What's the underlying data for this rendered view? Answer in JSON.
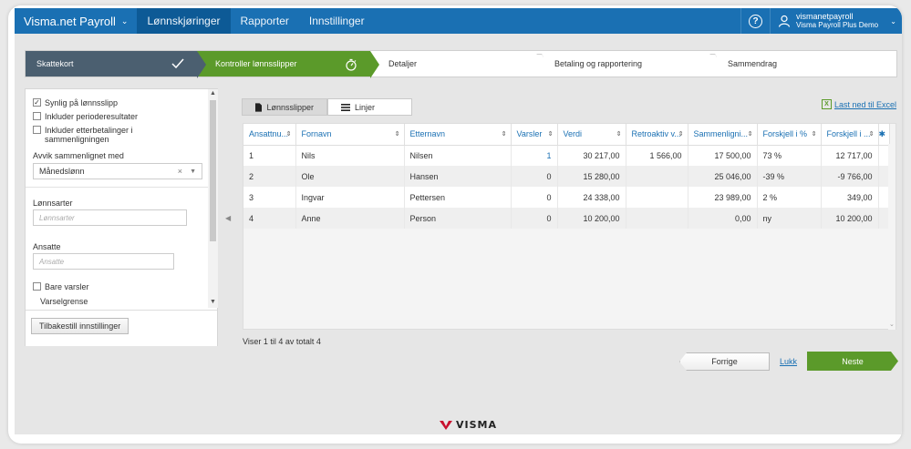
{
  "topbar": {
    "brand": "Visma.net Payroll",
    "nav": [
      "Lønnskjøringer",
      "Rapporter",
      "Innstillinger"
    ],
    "active_nav": "Lønnskjøringer",
    "user_name": "vismanetpayroll",
    "user_company": "Visma Payroll Plus Demo"
  },
  "wizard": {
    "steps": [
      "Skattekort",
      "Kontroller lønnsslipper",
      "Detaljer",
      "Betaling og rapportering",
      "Sammendrag"
    ],
    "current": "Kontroller lønnsslipper"
  },
  "filters": {
    "checkbox_visible": "Synlig på lønnsslipp",
    "checkbox_visible_checked": true,
    "checkbox_period": "Inkluder perioderesultater",
    "checkbox_after": "Inkluder etterbetalinger i sammenligningen",
    "compare_label": "Avvik sammenlignet med",
    "compare_value": "Månedslønn",
    "wage_types_label": "Lønnsarter",
    "wage_types_placeholder": "Lønnsarter",
    "employees_label": "Ansatte",
    "employees_placeholder": "Ansatte",
    "only_warnings": "Bare varsler",
    "warning_limit": "Varselgrense",
    "reset_button": "Tilbakestill innstillinger"
  },
  "tabs": [
    "Lønnsslipper",
    "Linjer"
  ],
  "download_excel": "Last ned til Excel",
  "table": {
    "columns": [
      "Ansattnu...",
      "Fornavn",
      "Etternavn",
      "Varsler",
      "Verdi",
      "Retroaktiv v...",
      "Sammenligni...",
      "Forskjell i %",
      "Forskjell i ..."
    ],
    "rows": [
      [
        "1",
        "Nils",
        "Nilsen",
        "1",
        "30 217,00",
        "1 566,00",
        "17 500,00",
        "73 %",
        "12 717,00"
      ],
      [
        "2",
        "Ole",
        "Hansen",
        "0",
        "15 280,00",
        "",
        "25 046,00",
        "-39 %",
        "-9 766,00"
      ],
      [
        "3",
        "Ingvar",
        "Pettersen",
        "0",
        "24 338,00",
        "",
        "23 989,00",
        "2 %",
        "349,00"
      ],
      [
        "4",
        "Anne",
        "Person",
        "0",
        "10 200,00",
        "",
        "0,00",
        "ny",
        "10 200,00"
      ]
    ]
  },
  "footer": {
    "viewing": "Viser 1 til 4 av totalt 4",
    "prev": "Forrige",
    "close": "Lukk",
    "next": "Neste",
    "logo": "VISMA"
  },
  "colors": {
    "primary": "#1a70b3",
    "success": "#5b9a2a",
    "step_done": "#4b5f70"
  }
}
